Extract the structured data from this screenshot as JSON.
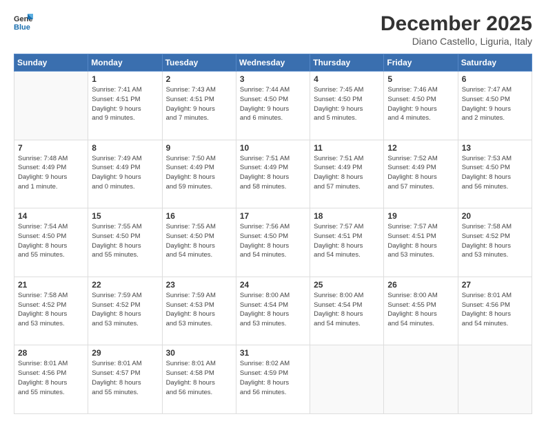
{
  "header": {
    "logo_line1": "General",
    "logo_line2": "Blue",
    "month": "December 2025",
    "location": "Diano Castello, Liguria, Italy"
  },
  "weekdays": [
    "Sunday",
    "Monday",
    "Tuesday",
    "Wednesday",
    "Thursday",
    "Friday",
    "Saturday"
  ],
  "weeks": [
    [
      {
        "day": "",
        "info": ""
      },
      {
        "day": "1",
        "info": "Sunrise: 7:41 AM\nSunset: 4:51 PM\nDaylight: 9 hours\nand 9 minutes."
      },
      {
        "day": "2",
        "info": "Sunrise: 7:43 AM\nSunset: 4:51 PM\nDaylight: 9 hours\nand 7 minutes."
      },
      {
        "day": "3",
        "info": "Sunrise: 7:44 AM\nSunset: 4:50 PM\nDaylight: 9 hours\nand 6 minutes."
      },
      {
        "day": "4",
        "info": "Sunrise: 7:45 AM\nSunset: 4:50 PM\nDaylight: 9 hours\nand 5 minutes."
      },
      {
        "day": "5",
        "info": "Sunrise: 7:46 AM\nSunset: 4:50 PM\nDaylight: 9 hours\nand 4 minutes."
      },
      {
        "day": "6",
        "info": "Sunrise: 7:47 AM\nSunset: 4:50 PM\nDaylight: 9 hours\nand 2 minutes."
      }
    ],
    [
      {
        "day": "7",
        "info": "Sunrise: 7:48 AM\nSunset: 4:49 PM\nDaylight: 9 hours\nand 1 minute."
      },
      {
        "day": "8",
        "info": "Sunrise: 7:49 AM\nSunset: 4:49 PM\nDaylight: 9 hours\nand 0 minutes."
      },
      {
        "day": "9",
        "info": "Sunrise: 7:50 AM\nSunset: 4:49 PM\nDaylight: 8 hours\nand 59 minutes."
      },
      {
        "day": "10",
        "info": "Sunrise: 7:51 AM\nSunset: 4:49 PM\nDaylight: 8 hours\nand 58 minutes."
      },
      {
        "day": "11",
        "info": "Sunrise: 7:51 AM\nSunset: 4:49 PM\nDaylight: 8 hours\nand 57 minutes."
      },
      {
        "day": "12",
        "info": "Sunrise: 7:52 AM\nSunset: 4:49 PM\nDaylight: 8 hours\nand 57 minutes."
      },
      {
        "day": "13",
        "info": "Sunrise: 7:53 AM\nSunset: 4:50 PM\nDaylight: 8 hours\nand 56 minutes."
      }
    ],
    [
      {
        "day": "14",
        "info": "Sunrise: 7:54 AM\nSunset: 4:50 PM\nDaylight: 8 hours\nand 55 minutes."
      },
      {
        "day": "15",
        "info": "Sunrise: 7:55 AM\nSunset: 4:50 PM\nDaylight: 8 hours\nand 55 minutes."
      },
      {
        "day": "16",
        "info": "Sunrise: 7:55 AM\nSunset: 4:50 PM\nDaylight: 8 hours\nand 54 minutes."
      },
      {
        "day": "17",
        "info": "Sunrise: 7:56 AM\nSunset: 4:50 PM\nDaylight: 8 hours\nand 54 minutes."
      },
      {
        "day": "18",
        "info": "Sunrise: 7:57 AM\nSunset: 4:51 PM\nDaylight: 8 hours\nand 54 minutes."
      },
      {
        "day": "19",
        "info": "Sunrise: 7:57 AM\nSunset: 4:51 PM\nDaylight: 8 hours\nand 53 minutes."
      },
      {
        "day": "20",
        "info": "Sunrise: 7:58 AM\nSunset: 4:52 PM\nDaylight: 8 hours\nand 53 minutes."
      }
    ],
    [
      {
        "day": "21",
        "info": "Sunrise: 7:58 AM\nSunset: 4:52 PM\nDaylight: 8 hours\nand 53 minutes."
      },
      {
        "day": "22",
        "info": "Sunrise: 7:59 AM\nSunset: 4:52 PM\nDaylight: 8 hours\nand 53 minutes."
      },
      {
        "day": "23",
        "info": "Sunrise: 7:59 AM\nSunset: 4:53 PM\nDaylight: 8 hours\nand 53 minutes."
      },
      {
        "day": "24",
        "info": "Sunrise: 8:00 AM\nSunset: 4:54 PM\nDaylight: 8 hours\nand 53 minutes."
      },
      {
        "day": "25",
        "info": "Sunrise: 8:00 AM\nSunset: 4:54 PM\nDaylight: 8 hours\nand 54 minutes."
      },
      {
        "day": "26",
        "info": "Sunrise: 8:00 AM\nSunset: 4:55 PM\nDaylight: 8 hours\nand 54 minutes."
      },
      {
        "day": "27",
        "info": "Sunrise: 8:01 AM\nSunset: 4:56 PM\nDaylight: 8 hours\nand 54 minutes."
      }
    ],
    [
      {
        "day": "28",
        "info": "Sunrise: 8:01 AM\nSunset: 4:56 PM\nDaylight: 8 hours\nand 55 minutes."
      },
      {
        "day": "29",
        "info": "Sunrise: 8:01 AM\nSunset: 4:57 PM\nDaylight: 8 hours\nand 55 minutes."
      },
      {
        "day": "30",
        "info": "Sunrise: 8:01 AM\nSunset: 4:58 PM\nDaylight: 8 hours\nand 56 minutes."
      },
      {
        "day": "31",
        "info": "Sunrise: 8:02 AM\nSunset: 4:59 PM\nDaylight: 8 hours\nand 56 minutes."
      },
      {
        "day": "",
        "info": ""
      },
      {
        "day": "",
        "info": ""
      },
      {
        "day": "",
        "info": ""
      }
    ]
  ]
}
